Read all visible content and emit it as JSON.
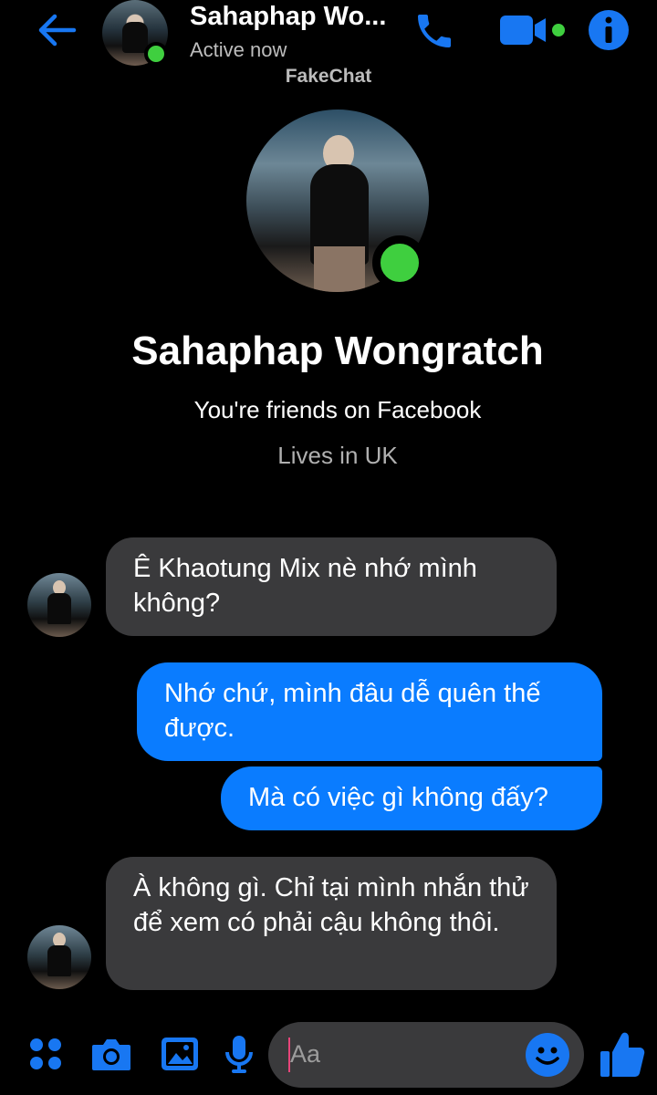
{
  "header": {
    "contact_name": "Sahaphap Wo...",
    "status": "Active now",
    "watermark": "FakeChat"
  },
  "profile": {
    "name": "Sahaphap Wongratch",
    "friends_text": "You're friends on Facebook",
    "lives_text": "Lives in UK"
  },
  "messages": [
    {
      "direction": "incoming",
      "text": "Ê Khaotung Mix nè nhớ mình không?"
    },
    {
      "direction": "outgoing",
      "text": "Nhớ chứ, mình đâu dễ quên thế được."
    },
    {
      "direction": "outgoing",
      "text": "Mà có việc gì không đấy?"
    },
    {
      "direction": "incoming",
      "text": "À không gì. Chỉ tại mình nhắn thử để xem có phải cậu không thôi."
    }
  ],
  "composer": {
    "placeholder": "Aa"
  },
  "colors": {
    "accent": "#1877f2",
    "outgoing_bubble": "#0a7cff",
    "incoming_bubble": "#3a3a3c",
    "online": "#3fcf3f",
    "background": "#000000"
  },
  "icons": [
    "back-arrow-icon",
    "phone-icon",
    "video-camera-icon",
    "info-icon",
    "apps-grid-icon",
    "camera-icon",
    "image-icon",
    "microphone-icon",
    "emoji-icon",
    "thumbs-up-icon"
  ]
}
